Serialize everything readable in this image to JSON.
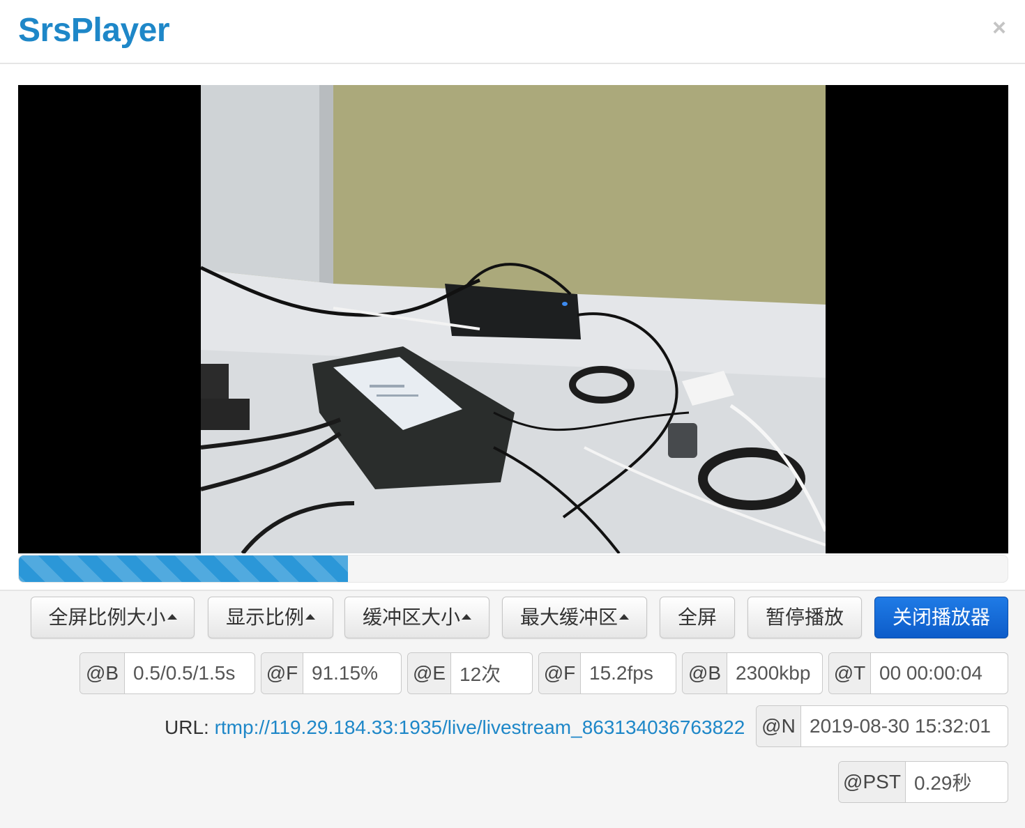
{
  "header": {
    "title": "SrsPlayer",
    "close": "×"
  },
  "player": {
    "buffer_progress_percent": 33.3
  },
  "controls": {
    "buttons": [
      {
        "label": "全屏比例大小",
        "dropdown": true
      },
      {
        "label": "显示比例",
        "dropdown": true
      },
      {
        "label": "缓冲区大小",
        "dropdown": true
      },
      {
        "label": "最大缓冲区",
        "dropdown": true
      },
      {
        "label": "全屏",
        "dropdown": false
      },
      {
        "label": "暂停播放",
        "dropdown": false
      },
      {
        "label": "关闭播放器",
        "dropdown": false,
        "primary": true
      }
    ]
  },
  "stats": {
    "buffer": {
      "key": "@B",
      "value": "0.5/0.5/1.5s"
    },
    "fps_ratio": {
      "key": "@F",
      "value": "91.15%"
    },
    "errors": {
      "key": "@E",
      "value": "12次"
    },
    "fps": {
      "key": "@F",
      "value": "15.2fps"
    },
    "bitrate": {
      "key": "@B",
      "value": "2300kbp"
    },
    "time": {
      "key": "@T",
      "value": "00 00:00:04"
    },
    "now": {
      "key": "@N",
      "value": "2019-08-30 15:32:01"
    },
    "pst": {
      "key": "@PST",
      "value": "0.29秒"
    }
  },
  "url": {
    "label": "URL:",
    "value": "rtmp://119.29.184.33:1935/live/livestream_863134036763822"
  },
  "colors": {
    "brand": "#1e87c8",
    "primary_button": "#0d5cc9",
    "progress": "#2b97d8"
  }
}
